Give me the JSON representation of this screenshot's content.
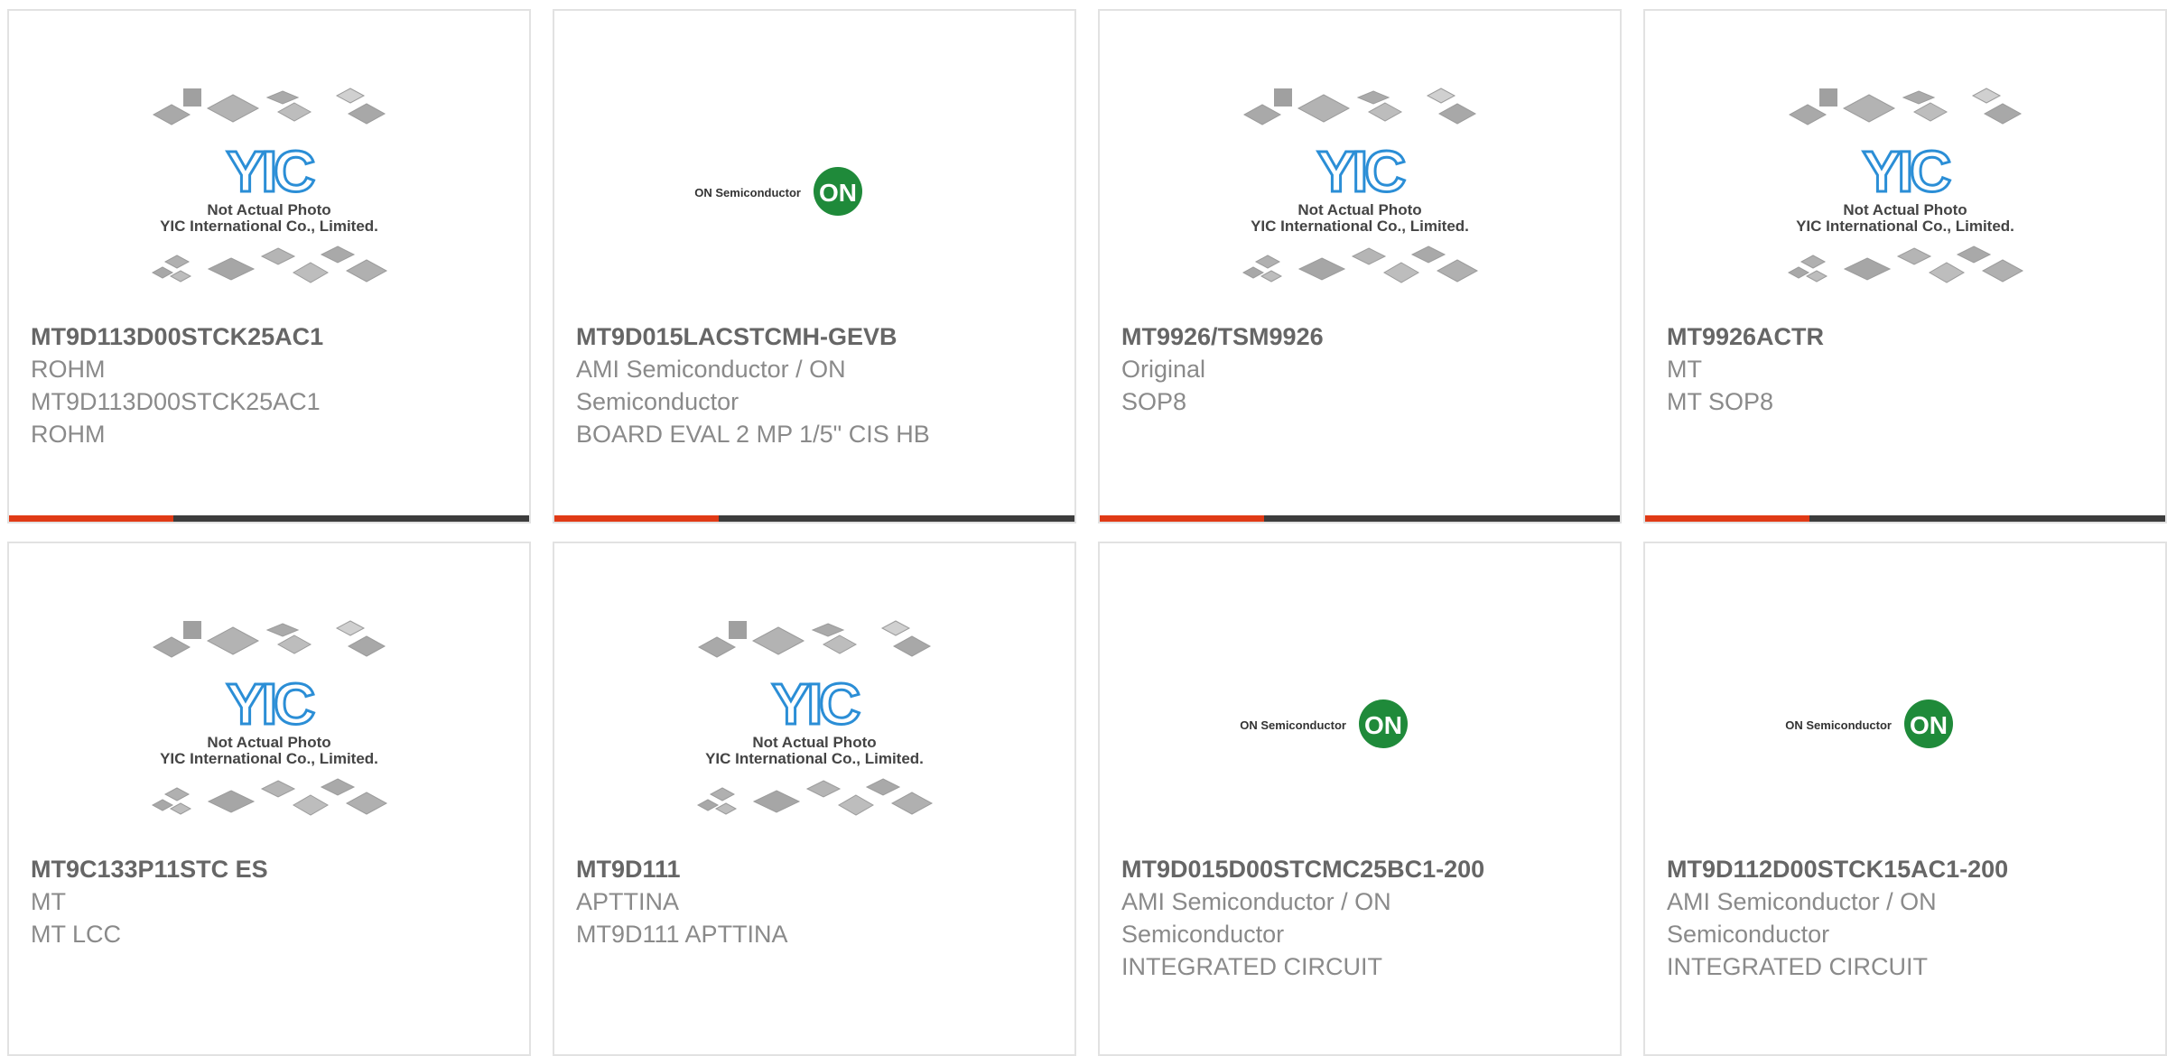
{
  "colors": {
    "accent_bar": "#e03a16",
    "dark_bar": "#3c3c3c",
    "title_text": "#666666",
    "detail_text": "#8a8a8a",
    "yic_blue": "#2b8ed6",
    "on_green": "#1f8a3a"
  },
  "placeholder_yic": {
    "logo_text": "YIC",
    "caption_line1": "Not Actual Photo",
    "caption_line2": "YIC International Co., Limited."
  },
  "placeholder_on": {
    "wordmark": "ON Semiconductor",
    "badge": "ON"
  },
  "products": [
    {
      "image": "yic-placeholder",
      "part": "MT9D113D00STCK25AC1",
      "line1": "ROHM",
      "line2": "MT9D113D00STCK25AC1",
      "line3": "ROHM",
      "has_bar": true
    },
    {
      "image": "on-semi-logo",
      "part": "MT9D015LACSTCMH-GEVB",
      "line1": "AMI Semiconductor / ON",
      "line2": "Semiconductor",
      "line3": "BOARD EVAL 2 MP 1/5\" CIS HB",
      "has_bar": true
    },
    {
      "image": "yic-placeholder",
      "part": "MT9926/TSM9926",
      "line1": "Original",
      "line2": "SOP8",
      "line3": "",
      "has_bar": true
    },
    {
      "image": "yic-placeholder",
      "part": "MT9926ACTR",
      "line1": "MT",
      "line2": "MT SOP8",
      "line3": "",
      "has_bar": true
    },
    {
      "image": "yic-placeholder",
      "part": "MT9C133P11STC ES",
      "line1": "MT",
      "line2": "MT LCC",
      "line3": "",
      "has_bar": false
    },
    {
      "image": "yic-placeholder",
      "part": "MT9D111",
      "line1": "APTTINA",
      "line2": "MT9D111 APTTINA",
      "line3": "",
      "has_bar": false
    },
    {
      "image": "on-semi-logo",
      "part": "MT9D015D00STCMC25BC1-200",
      "line1": "AMI Semiconductor / ON",
      "line2": "Semiconductor",
      "line3": "INTEGRATED CIRCUIT",
      "has_bar": false
    },
    {
      "image": "on-semi-logo",
      "part": "MT9D112D00STCK15AC1-200",
      "line1": "AMI Semiconductor / ON",
      "line2": "Semiconductor",
      "line3": "INTEGRATED CIRCUIT",
      "has_bar": false
    }
  ]
}
